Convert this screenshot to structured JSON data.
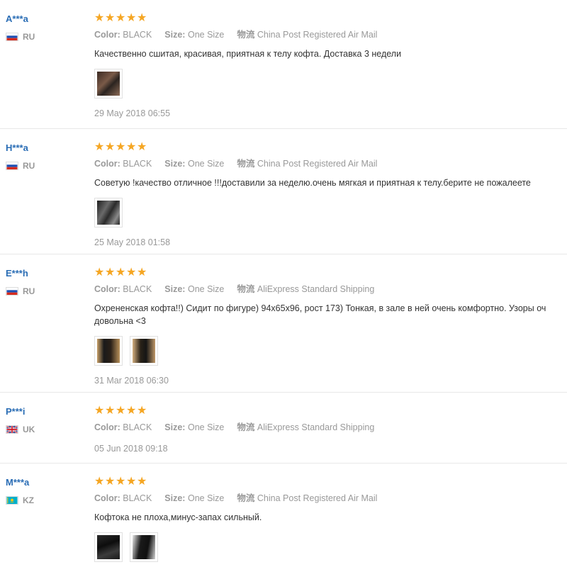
{
  "labels": {
    "color": "Color:",
    "size": "Size:",
    "shipping_prefix": "物流"
  },
  "reviews": [
    {
      "user": "A***a",
      "country": "RU",
      "flag": "ru-flag-icon",
      "rating": 5,
      "color": "BLACK",
      "size": "One Size",
      "shipping": "China Post Registered Air Mail",
      "text": "Качественно сшитая, красивая, приятная к телу кофта. Доставка 3 недели",
      "photos": 1,
      "date": "29 May 2018 06:55"
    },
    {
      "user": "H***a",
      "country": "RU",
      "flag": "ru-flag-icon",
      "rating": 5,
      "color": "BLACK",
      "size": "One Size",
      "shipping": "China Post Registered Air Mail",
      "text": "Советую !качество отличное !!!доставили за неделю.очень мягкая и приятная к телу.берите не пожалеете",
      "photos": 1,
      "date": "25 May 2018 01:58"
    },
    {
      "user": "E***h",
      "country": "RU",
      "flag": "ru-flag-icon",
      "rating": 5,
      "color": "BLACK",
      "size": "One Size",
      "shipping": "AliExpress Standard Shipping",
      "text": "Охренен­ская кофта!!) Сидит по фигуре) 94х65х96, рост 173) Тонкая, в зале в ней очень комфортно. Узоры оч",
      "text2": "довольна <3",
      "photos": 2,
      "date": "31 Mar 2018 06:30"
    },
    {
      "user": "P***i",
      "country": "UK",
      "flag": "uk-flag-icon",
      "rating": 5,
      "color": "BLACK",
      "size": "One Size",
      "shipping": "AliExpress Standard Shipping",
      "text": "",
      "photos": 0,
      "date": "05 Jun 2018 09:18"
    },
    {
      "user": "M***a",
      "country": "KZ",
      "flag": "kz-flag-icon",
      "rating": 5,
      "color": "BLACK",
      "size": "One Size",
      "shipping": "China Post Registered Air Mail",
      "text": "Кофтока не плоха,минус-запах сильный.",
      "photos": 2,
      "date": ""
    }
  ]
}
